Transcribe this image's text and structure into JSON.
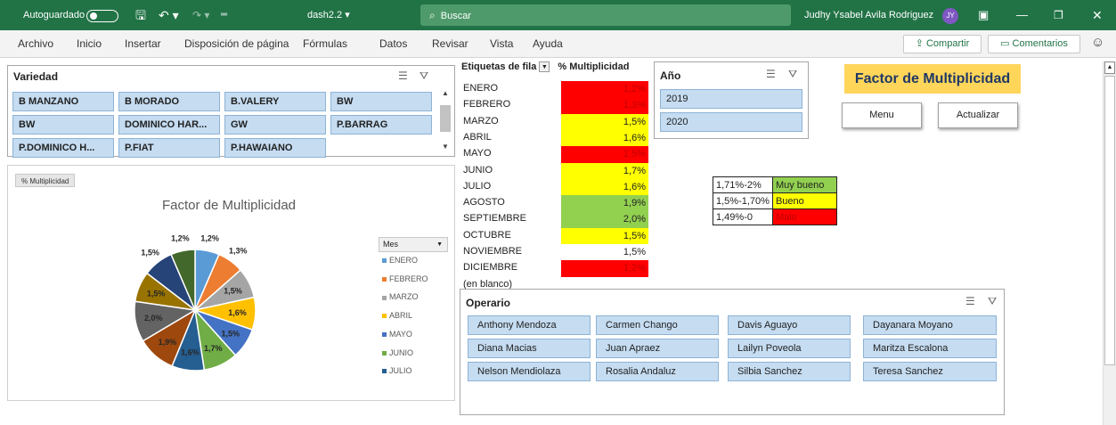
{
  "titlebar": {
    "autosave_label": "Autoguardado",
    "doc_name": "dash2.2 ▾",
    "search_placeholder": "Buscar",
    "user_name": "Judhy Ysabel Avila Rodriguez",
    "user_initials": "JY",
    "bg_color": "#217346"
  },
  "menu": {
    "items": [
      "Archivo",
      "Inicio",
      "Insertar",
      "Disposición de página",
      "Fórmulas",
      "Datos",
      "Revisar",
      "Vista",
      "Ayuda"
    ],
    "share_label": "Compartir",
    "comments_label": "Comentarios"
  },
  "slicer_variedad": {
    "title": "Variedad",
    "items": [
      "B MANZANO",
      "B MORADO",
      "B.VALERY",
      "BW",
      "BW",
      "DOMINICO HAR...",
      "GW",
      "P.BARRAG",
      "P.DOMINICO H...",
      "P.FIAT",
      "P.HAWAIANO"
    ]
  },
  "chart": {
    "field_button": "% Multiplicidad",
    "legend_field": "Mes"
  },
  "chart_data": {
    "type": "pie",
    "title": "Factor de Multiplicidad",
    "categories": [
      "ENERO",
      "FEBRERO",
      "MARZO",
      "ABRIL",
      "MAYO",
      "JUNIO",
      "JULIO",
      "AGOSTO",
      "SEPTIEMBRE",
      "OCTUBRE",
      "NOVIEMBRE",
      "DICIEMBRE"
    ],
    "values": [
      1.2,
      1.3,
      1.5,
      1.6,
      1.5,
      1.7,
      1.6,
      1.9,
      2.0,
      1.5,
      1.5,
      1.2
    ],
    "data_labels": [
      "1,2%",
      "1,3%",
      "1,5%",
      "1,6%",
      "1,5%",
      "1,7%",
      "1,6%",
      "1,9%",
      "2,0%",
      "1,5%",
      "1,5%",
      "1,2%"
    ],
    "colors": [
      "#5b9bd5",
      "#ed7d31",
      "#a5a5a5",
      "#ffc000",
      "#4472c4",
      "#70ad47",
      "#255e91",
      "#9e480e",
      "#636363",
      "#997300",
      "#264478",
      "#43682b"
    ],
    "legend_visible": [
      "ENERO",
      "FEBRERO",
      "MARZO",
      "ABRIL",
      "MAYO",
      "JUNIO",
      "JULIO"
    ],
    "legend_position": "right"
  },
  "pivot": {
    "header_rows": "Etiquetas de fila",
    "header_values": "% Multiplicidad",
    "rows": [
      {
        "label": "ENERO",
        "value": "1,2%",
        "bg": "#ff0000",
        "fg": "#c00000"
      },
      {
        "label": "FEBRERO",
        "value": "1,3%",
        "bg": "#ff0000",
        "fg": "#c00000"
      },
      {
        "label": "MARZO",
        "value": "1,5%",
        "bg": "#ffff00",
        "fg": "#222222"
      },
      {
        "label": "ABRIL",
        "value": "1,6%",
        "bg": "#ffff00",
        "fg": "#222222"
      },
      {
        "label": "MAYO",
        "value": "1,5%",
        "bg": "#ff0000",
        "fg": "#c00000"
      },
      {
        "label": "JUNIO",
        "value": "1,7%",
        "bg": "#ffff00",
        "fg": "#222222"
      },
      {
        "label": "JULIO",
        "value": "1,6%",
        "bg": "#ffff00",
        "fg": "#222222"
      },
      {
        "label": "AGOSTO",
        "value": "1,9%",
        "bg": "#92d050",
        "fg": "#222222"
      },
      {
        "label": "SEPTIEMBRE",
        "value": "2,0%",
        "bg": "#92d050",
        "fg": "#222222"
      },
      {
        "label": "OCTUBRE",
        "value": "1,5%",
        "bg": "#ffff00",
        "fg": "#222222"
      },
      {
        "label": "NOVIEMBRE",
        "value": "1,5%",
        "bg": "#ffffff",
        "fg": "#222222"
      },
      {
        "label": "DICIEMBRE",
        "value": "1,2%",
        "bg": "#ff0000",
        "fg": "#c00000"
      },
      {
        "label": "(en blanco)",
        "value": "",
        "bg": "#ffffff",
        "fg": "#222222"
      }
    ]
  },
  "slicer_anio": {
    "title": "Año",
    "items": [
      "2019",
      "2020"
    ]
  },
  "title_box": "Factor de Multiplicidad",
  "buttons": {
    "menu": "Menu",
    "actualizar": "Actualizar"
  },
  "legend_table": [
    {
      "range": "1,71%-2%",
      "label": "Muy bueno",
      "bg": "#92d050",
      "fg": "#222222"
    },
    {
      "range": "1,5%-1,70%",
      "label": "Bueno",
      "bg": "#ffff00",
      "fg": "#222222"
    },
    {
      "range": "1,49%-0",
      "label": "Malo",
      "bg": "#ff0000",
      "fg": "#c00000"
    }
  ],
  "slicer_operario": {
    "title": "Operario",
    "items": [
      "Anthony Mendoza",
      "Carmen Chango",
      "Davis Aguayo",
      "Dayanara Moyano",
      "Diana Macias",
      "Juan Apraez",
      "Lailyn Poveola",
      "Maritza Escalona",
      "Nelson Mendiolaza",
      "Rosalia Andaluz",
      "Silbia Sanchez",
      "Teresa Sanchez"
    ]
  }
}
